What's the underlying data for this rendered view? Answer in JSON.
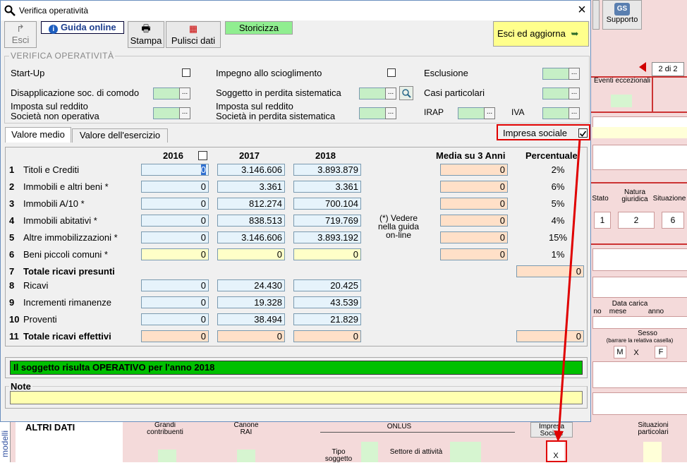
{
  "window": {
    "title": "Verifica operatività",
    "close_label": "×"
  },
  "toolbar": {
    "esci": "Esci",
    "guida": "Guida online",
    "stampa": "Stampa",
    "pulisci": "Pulisci dati",
    "storicizza": "Storicizza",
    "esci_aggiorna": "Esci ed aggiorna"
  },
  "bg": {
    "supporto": "Supporto",
    "pager": "2 di 2",
    "eventi": "Eventi eccezionali",
    "stato": "Stato",
    "natura": "Natura giuridica",
    "situazione": "Situazione",
    "stato_val": "1",
    "natura_val": "2",
    "situazione_val": "6",
    "data_carica": "Data carica",
    "mese": "mese",
    "anno": "anno",
    "no": "no",
    "sesso": "Sesso",
    "sesso_note": "(barrare la relativa casella)",
    "m": "M",
    "x1": "X",
    "f": "F",
    "altri_dati": "ALTRI DATI",
    "grandi": "Grandi contribuenti",
    "canone": "Canone RAI",
    "onlus": "ONLUS",
    "tipo_soggetto": "Tipo soggetto",
    "settore": "Settore di attività",
    "impresa_sociale": "Impresa Sociale",
    "x2": "X",
    "situazioni": "Situazioni particolari",
    "modelli": "modelli"
  },
  "group": {
    "title": "VERIFICA OPERATIVITÀ",
    "start_up": "Start-Up",
    "impegno": "Impegno allo scioglimento",
    "esclusione": "Esclusione",
    "disapplicazione": "Disapplicazione soc. di comodo",
    "perdita": "Soggetto in perdita sistematica",
    "casi": "Casi particolari",
    "imposta_non_op_1": "Imposta sul reddito",
    "imposta_non_op_2": "Società non operativa",
    "imposta_perdita_1": "Imposta sul reddito",
    "imposta_perdita_2": "Società in perdita sistematica",
    "irap": "IRAP",
    "iva": "IVA",
    "dots": "..."
  },
  "tabs": {
    "valore_medio": "Valore medio",
    "valore_esercizio": "Valore dell'esercizio"
  },
  "impresa_sociale": {
    "label": "Impresa sociale",
    "checked": true
  },
  "table": {
    "col_2016": "2016",
    "col_2017": "2017",
    "col_2018": "2018",
    "col_media": "Media su 3 Anni",
    "col_pct": "Percentuale",
    "note_1": "(*) Vedere",
    "note_2": "nella guida",
    "note_3": "on-line",
    "rows": [
      {
        "num": "1",
        "label": "Titoli e Crediti",
        "v2016": "0",
        "v2017": "3.146.606",
        "v2018": "3.893.879",
        "media": "0",
        "pct": "2%"
      },
      {
        "num": "2",
        "label": "Immobili e altri beni *",
        "v2016": "0",
        "v2017": "3.361",
        "v2018": "3.361",
        "media": "0",
        "pct": "6%"
      },
      {
        "num": "3",
        "label": "Immobili A/10 *",
        "v2016": "0",
        "v2017": "812.274",
        "v2018": "700.104",
        "media": "0",
        "pct": "5%"
      },
      {
        "num": "4",
        "label": "Immobili abitativi *",
        "v2016": "0",
        "v2017": "838.513",
        "v2018": "719.769",
        "media": "0",
        "pct": "4%"
      },
      {
        "num": "5",
        "label": "Altre immobilizzazioni *",
        "v2016": "0",
        "v2017": "3.146.606",
        "v2018": "3.893.192",
        "media": "0",
        "pct": "15%"
      },
      {
        "num": "6",
        "label": "Beni piccoli comuni *",
        "v2016": "0",
        "v2017": "0",
        "v2018": "0",
        "media": "0",
        "pct": "1%"
      },
      {
        "num": "7",
        "label": "Totale ricavi presunti",
        "total": "0"
      },
      {
        "num": "8",
        "label": "Ricavi",
        "v2016": "0",
        "v2017": "24.430",
        "v2018": "20.425"
      },
      {
        "num": "9",
        "label": "Incrementi rimanenze",
        "v2016": "0",
        "v2017": "19.328",
        "v2018": "43.539"
      },
      {
        "num": "10",
        "label": "Proventi",
        "v2016": "0",
        "v2017": "38.494",
        "v2018": "21.829"
      },
      {
        "num": "11",
        "label": "Totale ricavi effettivi",
        "v2016": "0",
        "v2017": "0",
        "v2018": "0",
        "total": "0"
      }
    ]
  },
  "result": "Il soggetto risulta OPERATIVO per l'anno 2018",
  "note_label": "Note",
  "colors": {
    "result_bg": "#00c000",
    "highlight": "#e00000"
  }
}
